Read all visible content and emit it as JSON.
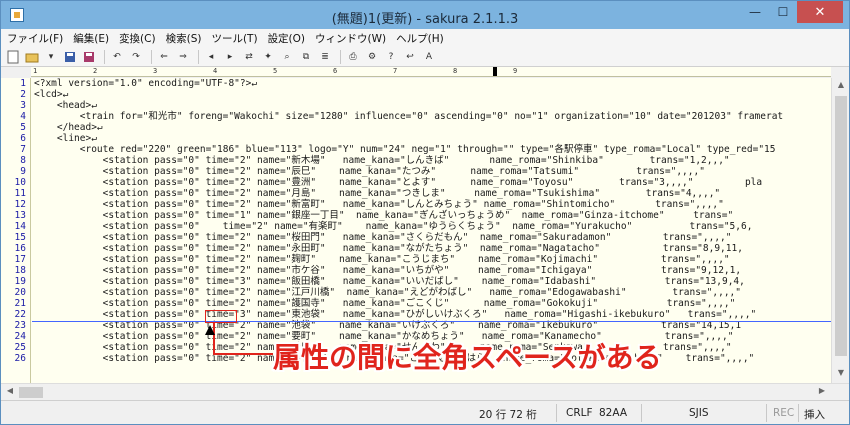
{
  "window": {
    "title": "(無題)1(更新) - sakura 2.1.1.3",
    "minimize": "—",
    "maximize": "☐",
    "close": "✕"
  },
  "menu": [
    "ファイル(F)",
    "編集(E)",
    "変換(C)",
    "検索(S)",
    "ツール(T)",
    "設定(O)",
    "ウィンドウ(W)",
    "ヘルプ(H)"
  ],
  "toolbar_icons": [
    "new-file-icon",
    "open-folder-icon",
    "dropdown-icon",
    "save-icon",
    "save-as-icon",
    "undo-icon",
    "redo-icon",
    "prev-icon",
    "next-icon",
    "search-prev-icon",
    "search-next-icon",
    "replace-icon",
    "bookmark-icon",
    "grep-icon",
    "compare-icon",
    "outline-icon",
    "print-icon",
    "settings-icon",
    "help-icon",
    "wrap-icon",
    "font-icon"
  ],
  "ruler": {
    "ticks": [
      "1",
      "2",
      "3",
      "4",
      "5",
      "6",
      "7",
      "8",
      "9"
    ]
  },
  "editor": {
    "line_numbers": [
      "1",
      "2",
      "3",
      "4",
      "5",
      "6",
      "7",
      "8",
      "9",
      "10",
      "11",
      "12",
      "13",
      "14",
      "15",
      "16",
      "17",
      "18",
      "19",
      "20",
      "21",
      "22",
      "23",
      "24",
      "25",
      "26"
    ],
    "lines": [
      "<?xml version=\"1.0\" encoding=\"UTF-8\"?>↵",
      "<lcd>↵",
      "    <head>↵",
      "        <train for=\"和光市\" foreng=\"Wakochi\" size=\"1280\" influence=\"0\" ascending=\"0\" no=\"1\" organization=\"10\" date=\"201203\" framerat",
      "    </head>↵",
      "    <line>↵",
      "        <route red=\"220\" green=\"186\" blue=\"113\" logo=\"Y\" num=\"24\" neg=\"1\" through=\"\" type=\"各駅停車\" type_roma=\"Local\" type_red=\"15",
      "            <station pass=\"0\" time=\"2\" name=\"新木場\"   name_kana=\"しんきば\"       name_roma=\"Shinkiba\"        trans=\"1,2,,,\"",
      "            <station pass=\"0\" time=\"2\" name=\"辰巳\"    name_kana=\"たつみ\"      name_roma=\"Tatsumi\"          trans=\",,,,\"",
      "            <station pass=\"0\" time=\"2\" name=\"豊洲\"    name_kana=\"とよす\"      name_roma=\"Toyosu\"        trans=\"3,,,,\"         pla",
      "            <station pass=\"0\" time=\"2\" name=\"月島\"    name_kana=\"つきしま\"     name_roma=\"Tsukishima\"        trans=\"4,,,,\"",
      "            <station pass=\"0\" time=\"2\" name=\"新富町\"   name_kana=\"しんとみちょう\" name_roma=\"Shintomicho\"       trans=\",,,,\"",
      "            <station pass=\"0\" time=\"1\" name=\"銀座一丁目\"  name_kana=\"ぎんざいっちょうめ\"  name_roma=\"Ginza-itchome\"     trans=\"",
      "            <station pass=\"0\"    time=\"2\" name=\"有楽町\"    name_kana=\"ゆうらくちょう\"  name_roma=\"Yurakucho\"          trans=\"5,6,",
      "            <station pass=\"0\" time=\"2\" name=\"桜田門\"   name_kana=\"さくらだもん\"  name_roma=\"Sakuradamon\"         trans=\",,,,\"",
      "            <station pass=\"0\" time=\"2\" name=\"永田町\"   name_kana=\"ながたちょう\"  name_roma=\"Nagatacho\"           trans=\"8,9,11,",
      "            <station pass=\"0\" time=\"2\" name=\"麹町\"    name_kana=\"こうじまち\"    name_roma=\"Kojimachi\"           trans=\",,,,\"",
      "            <station pass=\"0\" time=\"2\" name=\"市ケ谷\"   name_kana=\"いちがや\"     name_roma=\"Ichigaya\"            trans=\"9,12,1,",
      "            <station pass=\"0\" time=\"3\" name=\"飯田橋\"   name_kana=\"いいだばし\"    name_roma=\"Idabashi\"            trans=\"13,9,4,",
      "            <station pass=\"0\" time=\"2\" name=\"江戸川橋\"  name_kana=\"えどがわばし\"   name_roma=\"Edogawabashi\"        trans=\",,,,\"",
      "            <station pass=\"0\" time=\"2\" name=\"護国寺\"   name_kana=\"ごこくじ\"      name_roma=\"Gokokuji\"            trans=\",,,,\"",
      "            <station pass=\"0\" time=\"3\" name=\"東池袋\"   name_kana=\"ひがしいけぶくろ\"   name_roma=\"Higashi-ikebukuro\"   trans=\",,,,\"",
      "            <station pass=\"0\" time=\"2\" name=\"池袋\"    name_kana=\"いけぶくろ\"    name_roma=\"Ikebukuro\"           trans=\"14,15,1",
      "            <station pass=\"0\" time=\"2\" name=\"要町\"    name_kana=\"かなめちょう\"   name_roma=\"Kanamecho\"           trans=\",,,,\"",
      "            <station pass=\"0\" time=\"2\" name=\"千川\"    name_kana=\"せんかわ\"      name_roma=\"Senkawa\"             trans=\",,,,\"",
      "            <station pass=\"0\" time=\"2\" name=\"小竹向原\"  name_kana=\"こたけむかいはら\"  name_roma=\"Kotake-mukaihara\"    trans=\",,,,\""
    ]
  },
  "annotation": {
    "text": "属性の間に全角スペースがある"
  },
  "status": {
    "position": "20 行  72 桁",
    "line_ending": "CRLF",
    "char_code": "82AA",
    "encoding": "SJIS",
    "rec": "REC",
    "insert_mode": "挿入"
  }
}
